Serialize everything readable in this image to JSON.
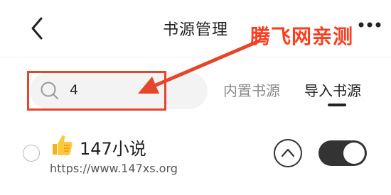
{
  "header": {
    "title": "书源管理",
    "back_icon": "chevron-left-icon",
    "more_icon": "more-dots-icon"
  },
  "annotation": {
    "watermark_text": "腾飞网亲测",
    "color": "#e4462c"
  },
  "search": {
    "value": "4",
    "icon": "search-icon"
  },
  "tabs": [
    {
      "label": "内置书源",
      "active": false
    },
    {
      "label": "导入书源",
      "active": true
    }
  ],
  "sources": [
    {
      "icon": "thumbs-up-icon",
      "name": "147小说",
      "url": "https://www.147xs.org",
      "selected": false,
      "enabled": true
    }
  ]
}
